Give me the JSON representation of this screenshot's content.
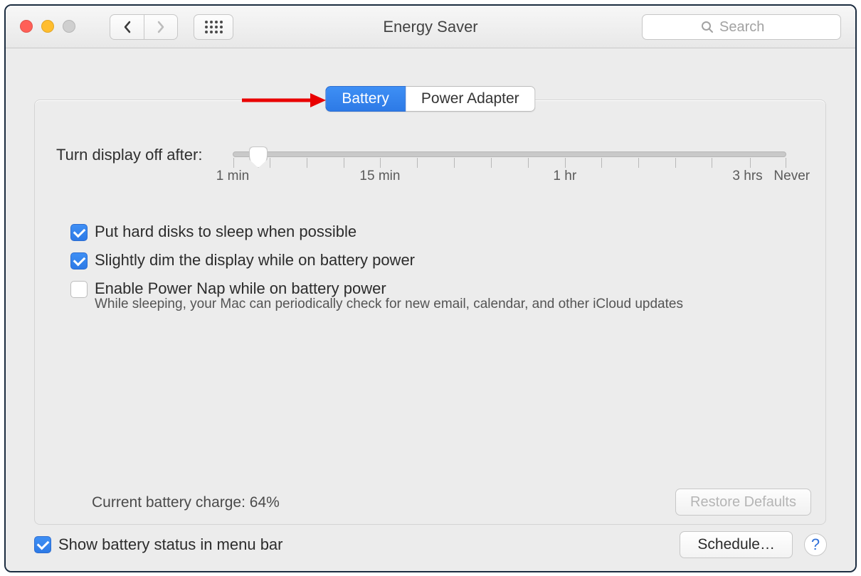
{
  "window": {
    "title": "Energy Saver"
  },
  "search": {
    "placeholder": "Search"
  },
  "tabs": {
    "battery": "Battery",
    "power_adapter": "Power Adapter",
    "active": "battery"
  },
  "slider": {
    "label": "Turn display off after:",
    "ticks": [
      "1 min",
      "15 min",
      "1 hr",
      "3 hrs",
      "Never"
    ]
  },
  "options": {
    "hard_disks": {
      "label": "Put hard disks to sleep when possible",
      "checked": true
    },
    "dim_display": {
      "label": "Slightly dim the display while on battery power",
      "checked": true
    },
    "power_nap": {
      "label": "Enable Power Nap while on battery power",
      "checked": false,
      "description": "While sleeping, your Mac can periodically check for new email, calendar, and other iCloud updates"
    }
  },
  "status": {
    "battery_charge": "Current battery charge: 64%"
  },
  "buttons": {
    "restore_defaults": "Restore Defaults",
    "schedule": "Schedule…"
  },
  "footer": {
    "show_battery": {
      "label": "Show battery status in menu bar",
      "checked": true
    }
  },
  "help": "?"
}
